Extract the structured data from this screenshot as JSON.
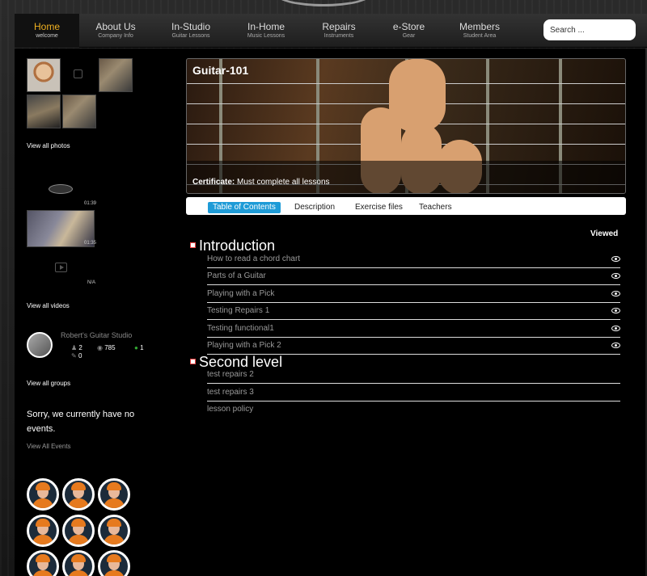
{
  "nav": {
    "items": [
      {
        "label": "Home",
        "sub": "welcome"
      },
      {
        "label": "About Us",
        "sub": "Company Info"
      },
      {
        "label": "In-Studio",
        "sub": "Guitar Lessons"
      },
      {
        "label": "In-Home",
        "sub": "Music Lessons"
      },
      {
        "label": "Repairs",
        "sub": "Instruments"
      },
      {
        "label": "e-Store",
        "sub": "Gear"
      },
      {
        "label": "Members",
        "sub": "Student Area"
      }
    ],
    "active": "Home",
    "search_placeholder": "Search ..."
  },
  "sidebar": {
    "view_photos": "View all photos",
    "videos": [
      {
        "duration": "01:39"
      },
      {
        "duration": "01:35"
      },
      {
        "duration": "N/A"
      }
    ],
    "view_videos": "View all videos",
    "group": {
      "name": "Robert's Guitar Studio",
      "members": "2",
      "views": "785",
      "comments": "1",
      "edits": "0"
    },
    "view_groups": "View all groups",
    "no_events": "Sorry, we currently have no events.",
    "view_events": "View All Events"
  },
  "hero": {
    "title": "Guitar-101",
    "cert_label": "Certificate:",
    "cert_text": "Must complete all lessons"
  },
  "tabs": [
    "Table of Contents",
    "Description",
    "Exercise files",
    "Teachers"
  ],
  "active_tab": "Table of Contents",
  "viewed_header": "Viewed",
  "sections": [
    {
      "title": "Introduction",
      "lessons": [
        {
          "title": "How to read a chord chart",
          "viewed": true
        },
        {
          "title": "Parts of a Guitar",
          "viewed": true
        },
        {
          "title": "Playing with a Pick",
          "viewed": true
        },
        {
          "title": "Testing Repairs 1",
          "viewed": true
        },
        {
          "title": "Testing functional1",
          "viewed": true
        },
        {
          "title": "Playing with a Pick 2",
          "viewed": true
        }
      ]
    },
    {
      "title": "Second level",
      "lessons": [
        {
          "title": "test repairs 2",
          "viewed": false
        },
        {
          "title": "test repairs 3",
          "viewed": false
        },
        {
          "title": "lesson policy",
          "viewed": false
        }
      ]
    }
  ],
  "colors": {
    "accent": "#f0b020",
    "tab_active": "#1e9bd7"
  }
}
